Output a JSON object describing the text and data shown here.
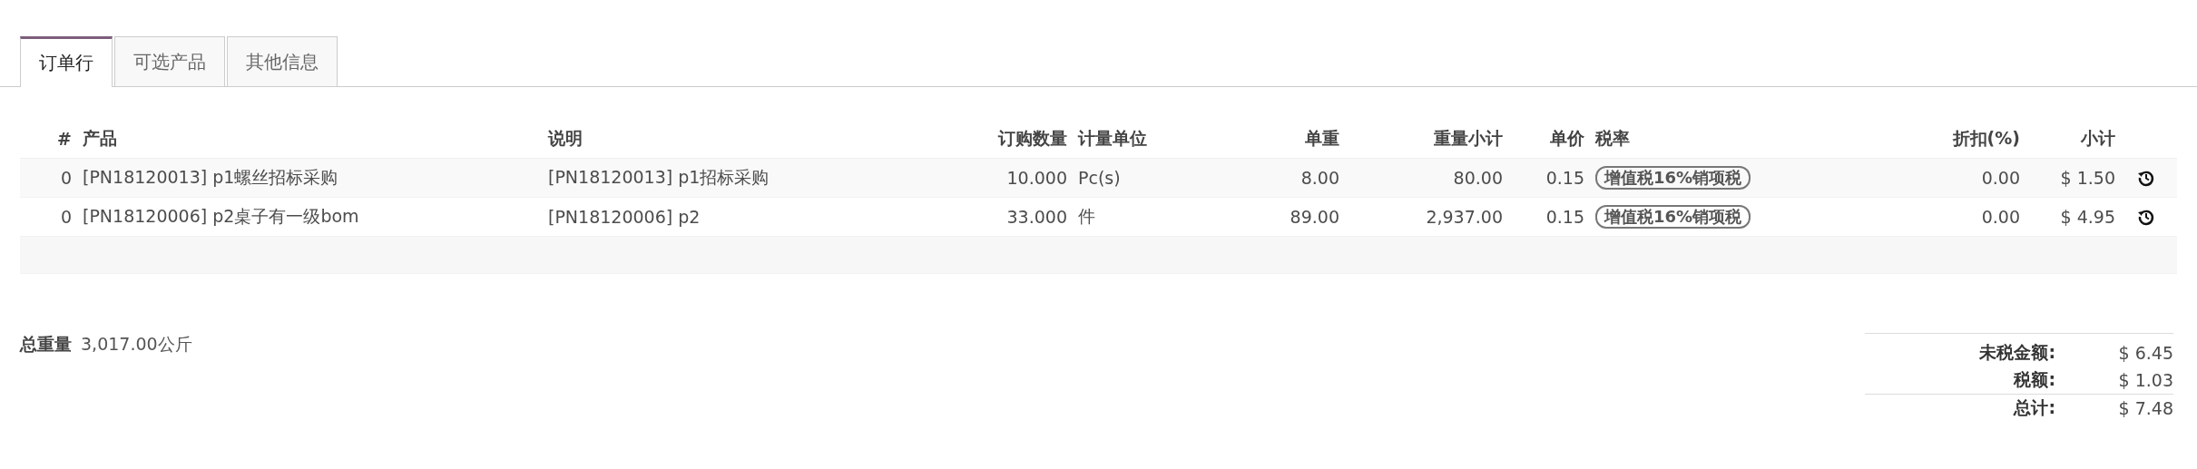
{
  "tabs": [
    {
      "label": "订单行",
      "selected": true
    },
    {
      "label": "可选产品",
      "selected": false
    },
    {
      "label": "其他信息",
      "selected": false
    }
  ],
  "table": {
    "columns": [
      "#",
      "产品",
      "说明",
      "订购数量",
      "计量单位",
      "单重",
      "重量小计",
      "单价",
      "税率",
      "折扣(%)",
      "小计"
    ],
    "rows": [
      {
        "sequence": "0",
        "product": "[PN18120013] p1螺丝招标采购",
        "description": "[PN18120013] p1招标采购",
        "quantity": "10.000",
        "uom": "Pc(s)",
        "unit_weight": "8.00",
        "weight_subtotal": "80.00",
        "unit_price": "0.15",
        "taxes": [
          "增值税16%销项税"
        ],
        "discount": "0.00",
        "subtotal": "$ 1.50"
      },
      {
        "sequence": "0",
        "product": "[PN18120006] p2桌子有一级bom",
        "description": "[PN18120006] p2",
        "quantity": "33.000",
        "uom": "件",
        "unit_weight": "89.00",
        "weight_subtotal": "2,937.00",
        "unit_price": "0.15",
        "taxes": [
          "增值税16%销项税"
        ],
        "discount": "0.00",
        "subtotal": "$ 4.95"
      }
    ]
  },
  "total_weight": {
    "label": "总重量",
    "value": "3,017.00公斤"
  },
  "totals": [
    {
      "label": "未税金额:",
      "value": "$ 6.45"
    },
    {
      "label": "税额:",
      "value": "$ 1.03"
    },
    {
      "label": "总计:",
      "value": "$ 7.48"
    }
  ]
}
